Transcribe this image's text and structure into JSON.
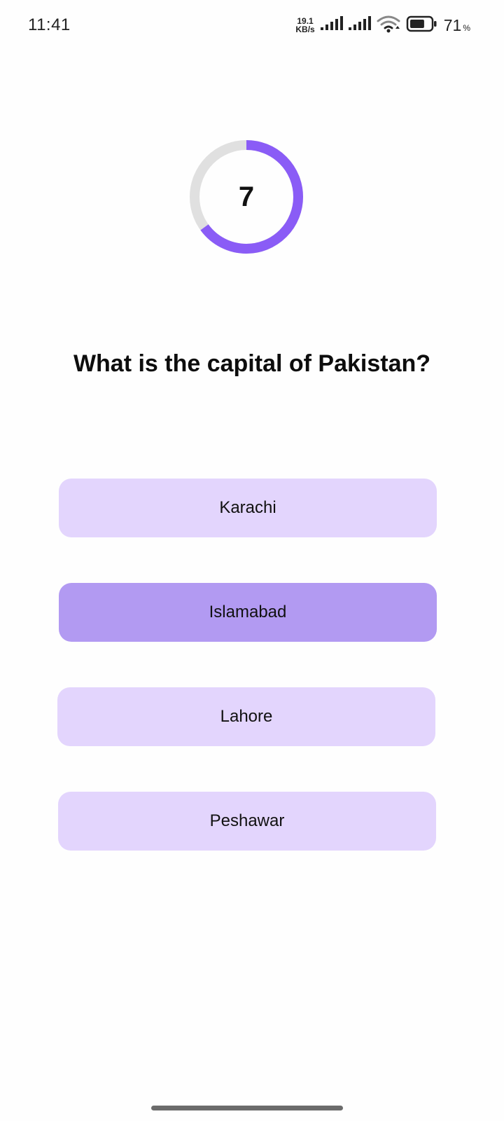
{
  "status_bar": {
    "time": "11:41",
    "net_speed_value": "19.1",
    "net_speed_unit": "KB/s",
    "battery_percent": "71",
    "battery_percent_sign": "%",
    "battery_level": 0.71,
    "icons": [
      "signal-icon",
      "signal-icon",
      "wifi-icon",
      "battery-icon"
    ]
  },
  "timer": {
    "value": "7",
    "progress": 0.65,
    "progress_color": "#8A5CF6",
    "track_color": "#E0E0E0"
  },
  "question": {
    "text": "What is the capital of Pakistan?"
  },
  "options": [
    {
      "label": "Karachi",
      "selected": false
    },
    {
      "label": "Islamabad",
      "selected": true
    },
    {
      "label": "Lahore",
      "selected": false
    },
    {
      "label": "Peshawar",
      "selected": false
    }
  ],
  "colors": {
    "option_bg": "#E3D5FD",
    "option_selected_bg": "#B29AF2"
  }
}
